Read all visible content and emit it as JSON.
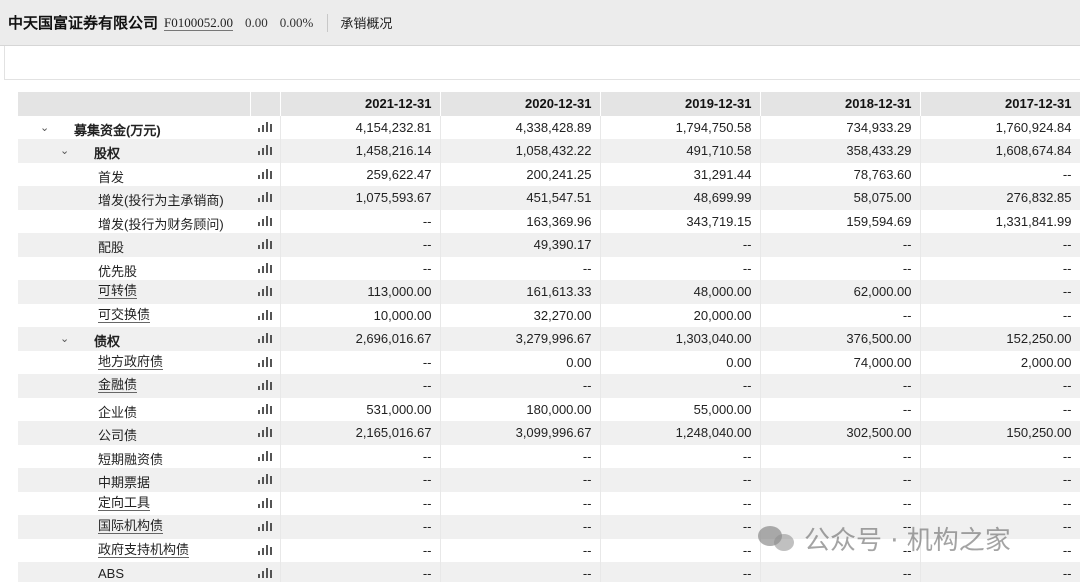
{
  "header": {
    "company_name": "中天国富证券有限公司",
    "code": "F0100052.00",
    "price": "0.00",
    "change_pct": "0.00%",
    "tab_label": "承销概况"
  },
  "table": {
    "columns": [
      "2021-12-31",
      "2020-12-31",
      "2019-12-31",
      "2018-12-31",
      "2017-12-31"
    ],
    "rows": [
      {
        "label": "募集资金(万元)",
        "level": 0,
        "expand": true,
        "bold": true,
        "underline": false,
        "values": [
          "4,154,232.81",
          "4,338,428.89",
          "1,794,750.58",
          "734,933.29",
          "1,760,924.84"
        ]
      },
      {
        "label": "股权",
        "level": 1,
        "expand": true,
        "bold": true,
        "underline": false,
        "values": [
          "1,458,216.14",
          "1,058,432.22",
          "491,710.58",
          "358,433.29",
          "1,608,674.84"
        ]
      },
      {
        "label": "首发",
        "level": 2,
        "expand": false,
        "bold": false,
        "underline": false,
        "values": [
          "259,622.47",
          "200,241.25",
          "31,291.44",
          "78,763.60",
          "--"
        ]
      },
      {
        "label": "增发(投行为主承销商)",
        "level": 2,
        "expand": false,
        "bold": false,
        "underline": false,
        "values": [
          "1,075,593.67",
          "451,547.51",
          "48,699.99",
          "58,075.00",
          "276,832.85"
        ]
      },
      {
        "label": "增发(投行为财务顾问)",
        "level": 2,
        "expand": false,
        "bold": false,
        "underline": false,
        "values": [
          "--",
          "163,369.96",
          "343,719.15",
          "159,594.69",
          "1,331,841.99"
        ]
      },
      {
        "label": "配股",
        "level": 2,
        "expand": false,
        "bold": false,
        "underline": false,
        "values": [
          "--",
          "49,390.17",
          "--",
          "--",
          "--"
        ]
      },
      {
        "label": "优先股",
        "level": 2,
        "expand": false,
        "bold": false,
        "underline": false,
        "values": [
          "--",
          "--",
          "--",
          "--",
          "--"
        ]
      },
      {
        "label": "可转债",
        "level": 2,
        "expand": false,
        "bold": false,
        "underline": true,
        "values": [
          "113,000.00",
          "161,613.33",
          "48,000.00",
          "62,000.00",
          "--"
        ]
      },
      {
        "label": "可交换债",
        "level": 2,
        "expand": false,
        "bold": false,
        "underline": true,
        "values": [
          "10,000.00",
          "32,270.00",
          "20,000.00",
          "--",
          "--"
        ]
      },
      {
        "label": "债权",
        "level": 1,
        "expand": true,
        "bold": true,
        "underline": false,
        "values": [
          "2,696,016.67",
          "3,279,996.67",
          "1,303,040.00",
          "376,500.00",
          "152,250.00"
        ]
      },
      {
        "label": "地方政府债",
        "level": 2,
        "expand": false,
        "bold": false,
        "underline": true,
        "values": [
          "--",
          "0.00",
          "0.00",
          "74,000.00",
          "2,000.00"
        ]
      },
      {
        "label": "金融债",
        "level": 2,
        "expand": false,
        "bold": false,
        "underline": true,
        "values": [
          "--",
          "--",
          "--",
          "--",
          "--"
        ]
      },
      {
        "label": "企业债",
        "level": 2,
        "expand": false,
        "bold": false,
        "underline": false,
        "values": [
          "531,000.00",
          "180,000.00",
          "55,000.00",
          "--",
          "--"
        ]
      },
      {
        "label": "公司债",
        "level": 2,
        "expand": false,
        "bold": false,
        "underline": false,
        "values": [
          "2,165,016.67",
          "3,099,996.67",
          "1,248,040.00",
          "302,500.00",
          "150,250.00"
        ]
      },
      {
        "label": "短期融资债",
        "level": 2,
        "expand": false,
        "bold": false,
        "underline": false,
        "values": [
          "--",
          "--",
          "--",
          "--",
          "--"
        ]
      },
      {
        "label": "中期票据",
        "level": 2,
        "expand": false,
        "bold": false,
        "underline": false,
        "values": [
          "--",
          "--",
          "--",
          "--",
          "--"
        ]
      },
      {
        "label": "定向工具",
        "level": 2,
        "expand": false,
        "bold": false,
        "underline": true,
        "values": [
          "--",
          "--",
          "--",
          "--",
          "--"
        ]
      },
      {
        "label": "国际机构债",
        "level": 2,
        "expand": false,
        "bold": false,
        "underline": true,
        "values": [
          "--",
          "--",
          "--",
          "--",
          "--"
        ]
      },
      {
        "label": "政府支持机构债",
        "level": 2,
        "expand": false,
        "bold": false,
        "underline": true,
        "values": [
          "--",
          "--",
          "--",
          "--",
          "--"
        ]
      },
      {
        "label": "ABS",
        "level": 2,
        "expand": false,
        "bold": false,
        "underline": false,
        "values": [
          "--",
          "--",
          "--",
          "--",
          "--"
        ]
      }
    ],
    "row_icon": "bar-chart-icon",
    "expand_icon": "chevron-down-icon"
  },
  "watermark": {
    "text": "公众号 · 机构之家",
    "icon": "wechat-icon"
  }
}
